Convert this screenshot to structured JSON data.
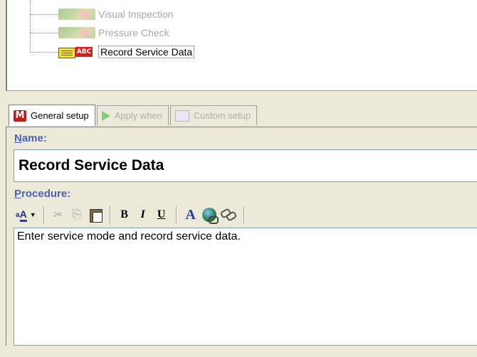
{
  "tree": {
    "nodes": [
      {
        "label": "Visual Inspection",
        "icon": "image-step-icon",
        "dimmed": true
      },
      {
        "label": "Pressure Check",
        "icon": "image-step-icon",
        "dimmed": true
      },
      {
        "label": "Record Service Data",
        "icon": "record-data-icon",
        "dimmed": false,
        "selected": true
      }
    ],
    "record_icon_text": "ABC"
  },
  "tabs": [
    {
      "label": "General setup",
      "icon": "general-setup-icon",
      "active": true
    },
    {
      "label": "Apply when",
      "icon": "play-icon",
      "active": false,
      "disabled": true
    },
    {
      "label": "Custom setup",
      "icon": "custom-setup-icon",
      "active": false,
      "disabled": true
    }
  ],
  "tab_icon_m": "M",
  "form": {
    "name_label_first": "N",
    "name_label_rest": "ame:",
    "name_value": "Record Service Data",
    "procedure_label_first": "P",
    "procedure_label_rest": "rocedure:",
    "procedure_text": "Enter service mode and record service data."
  },
  "toolbar": {
    "format": "A",
    "format_prefix": "a",
    "cut": "✂",
    "copy": "⎘",
    "bold": "B",
    "italic": "I",
    "underline": "U",
    "font_color": "A"
  },
  "colors": {
    "label_blue": "#4d62b2",
    "window_bg": "#ece9d8",
    "input_border": "#7f9db9"
  }
}
